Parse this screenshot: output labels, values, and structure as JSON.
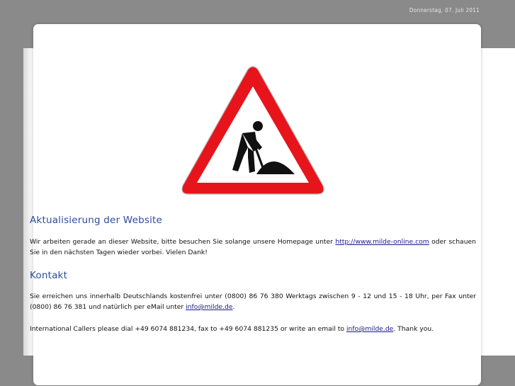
{
  "header": {
    "date": "Donnerstag, 07. Juli 2011"
  },
  "sign": {
    "icon": "road-works-warning-sign",
    "colors": {
      "border": "#e8141b",
      "fill": "#ffffff",
      "figure": "#111111"
    }
  },
  "update": {
    "heading": "Aktualisierung der Website",
    "text_before": "Wir arbeiten gerade an dieser Website, bitte besuchen Sie solange unsere Homepage unter ",
    "link": "http://www.milde-online.com",
    "text_after": " oder schauen Sie in den nächsten Tagen wieder vorbei. Vielen Dank!"
  },
  "contact": {
    "heading": "Kontakt",
    "text_before": "Sie erreichen uns innerhalb Deutschlands kostenfrei unter (0800) 86 76 380 Werktags zwischen 9 - 12 und 15 - 18 Uhr, per Fax unter (0800) 86 76 381 und natürlich per eMail unter ",
    "email": "info@milde.de",
    "text_after": ".",
    "intl_before": "International Callers please dial +49 6074 881234, fax to +49 6074 881235 or write an email to ",
    "intl_email": "info@milde.de",
    "intl_after": ". Thank you."
  },
  "colors": {
    "background": "#8a8a8a",
    "heading": "#2a4d99",
    "link": "#1a1a8c"
  }
}
